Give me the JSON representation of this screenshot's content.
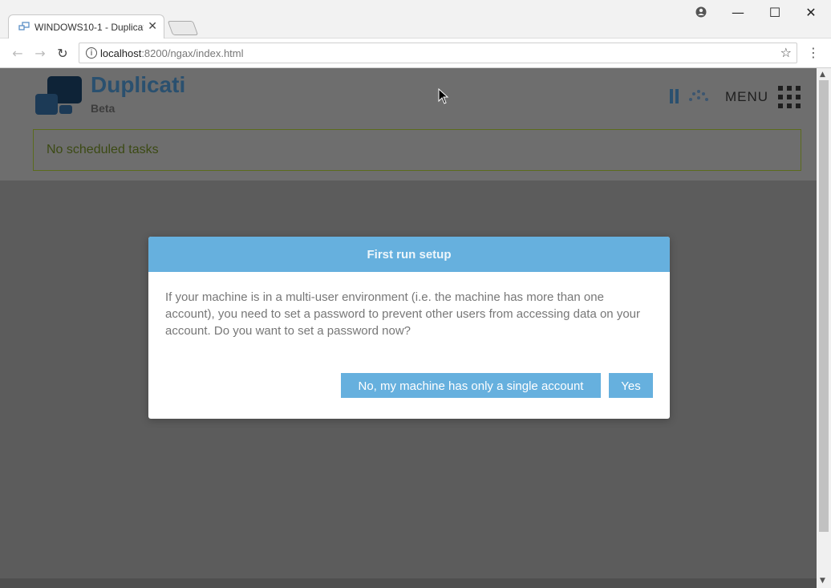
{
  "browser": {
    "tab_title": "WINDOWS10-1 - Duplicati",
    "close_glyph": "✕",
    "url_host": "localhost",
    "url_rest": ":8200/ngax/index.html",
    "window_controls": {
      "minimize": "—",
      "maximize": "☐",
      "close": "✕"
    }
  },
  "app": {
    "logo_title": "Duplicati",
    "logo_sub": "Beta",
    "menu_label": "MENU",
    "schedule_status": "No scheduled tasks",
    "colors": {
      "brand": "#2a506f",
      "dialog_accent": "#66b0de",
      "status_border": "#5b6b1c"
    }
  },
  "dialog": {
    "title": "First run setup",
    "body": "If your machine is in a multi-user environment (i.e. the machine has more than one account), you need to set a password to prevent other users from accessing data on your account. Do you want to set a password now?",
    "no_label": "No, my machine has only a single account",
    "yes_label": "Yes"
  },
  "icons": [
    "profile-icon",
    "back-arrow-icon",
    "forward-arrow-icon",
    "reload-icon",
    "info-icon",
    "star-icon",
    "more-vert-icon",
    "duplicati-logo-icon",
    "pause-icon",
    "throttle-spinner-icon",
    "menu-grid-icon",
    "mouse-cursor-icon"
  ]
}
